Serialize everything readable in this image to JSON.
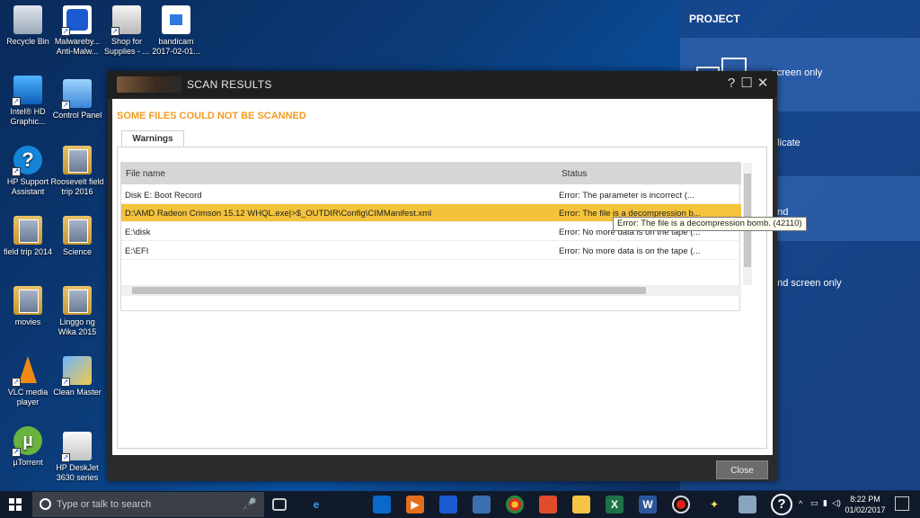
{
  "desktop": {
    "icons": [
      {
        "label": "Recycle Bin"
      },
      {
        "label": "Malwareby... Anti-Malw..."
      },
      {
        "label": "Shop for Supplies - ..."
      },
      {
        "label": "bandicam 2017-02-01..."
      },
      {
        "label": "Intel® HD Graphic..."
      },
      {
        "label": "Control Panel"
      },
      {
        "label": "HP Support Assistant"
      },
      {
        "label": "Roosevelt field trip 2016"
      },
      {
        "label": "field trip 2014"
      },
      {
        "label": "Science"
      },
      {
        "label": "movies"
      },
      {
        "label": "Linggo ng Wika 2015"
      },
      {
        "label": "VLC media player"
      },
      {
        "label": "Clean Master"
      },
      {
        "label": "µTorrent"
      },
      {
        "label": "HP DeskJet 3630 series"
      }
    ]
  },
  "project_panel": {
    "title": "PROJECT",
    "options": [
      "screen only",
      "plicate",
      "end",
      "ond screen only"
    ]
  },
  "dialog": {
    "title": "SCAN RESULTS",
    "help_glyph": "?",
    "maximize_glyph": "☐",
    "close_glyph": "✕",
    "warning_heading": "SOME FILES COULD NOT BE SCANNED",
    "tab_label": "Warnings",
    "columns": {
      "file": "File name",
      "status": "Status"
    },
    "rows": [
      {
        "file": "Disk E: Boot Record",
        "status": "Error: The parameter is incorrect (..."
      },
      {
        "file": "D:\\AMD Radeon Crimson 15.12 WHQL.exe|>$_OUTDIR\\Config\\CIMManifest.xml",
        "status": "Error: The file is a decompression b..."
      },
      {
        "file": "E:\\disk",
        "status": "Error: No more data is on the tape (..."
      },
      {
        "file": "E:\\EFI",
        "status": "Error: No more data is on the tape (..."
      }
    ],
    "tooltip": "Error: The file is a decompression bomb. (42110)",
    "close_button": "Close"
  },
  "taskbar": {
    "search_placeholder": "Type or talk to search",
    "time": "8:22 PM",
    "date": "01/02/2017"
  },
  "colors": {
    "accent": "#f39a1f",
    "selection": "#f3c33b"
  }
}
